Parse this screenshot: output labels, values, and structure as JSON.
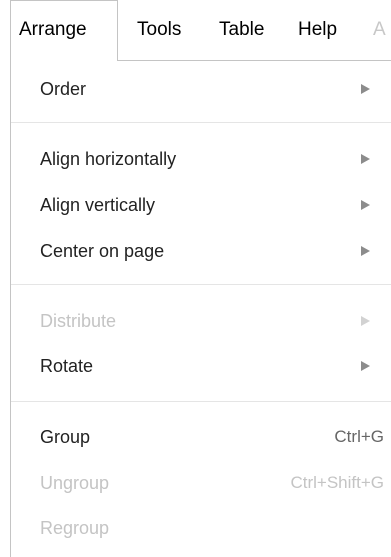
{
  "menubar": {
    "items": [
      {
        "label": "Arrange",
        "active": true
      },
      {
        "label": "Tools"
      },
      {
        "label": "Table"
      },
      {
        "label": "Help"
      },
      {
        "label": "A",
        "partially_visible": true
      }
    ]
  },
  "menu": {
    "items": [
      {
        "label": "Order",
        "submenu": true
      },
      {
        "label": "Align horizontally",
        "submenu": true
      },
      {
        "label": "Align vertically",
        "submenu": true
      },
      {
        "label": "Center on page",
        "submenu": true
      },
      {
        "label": "Distribute",
        "submenu": true,
        "disabled": true
      },
      {
        "label": "Rotate",
        "submenu": true
      },
      {
        "label": "Group",
        "shortcut": "Ctrl+G"
      },
      {
        "label": "Ungroup",
        "shortcut": "Ctrl+Shift+G",
        "disabled": true
      },
      {
        "label": "Regroup",
        "disabled": true
      }
    ]
  },
  "icons": {
    "submenu_arrow": "triangle-right-icon"
  },
  "colors": {
    "text": "#222222",
    "disabled_text": "#c4c4c4",
    "border": "#c4c4c4",
    "separator": "#e5e5e5",
    "arrow": "#8c8c8c"
  }
}
